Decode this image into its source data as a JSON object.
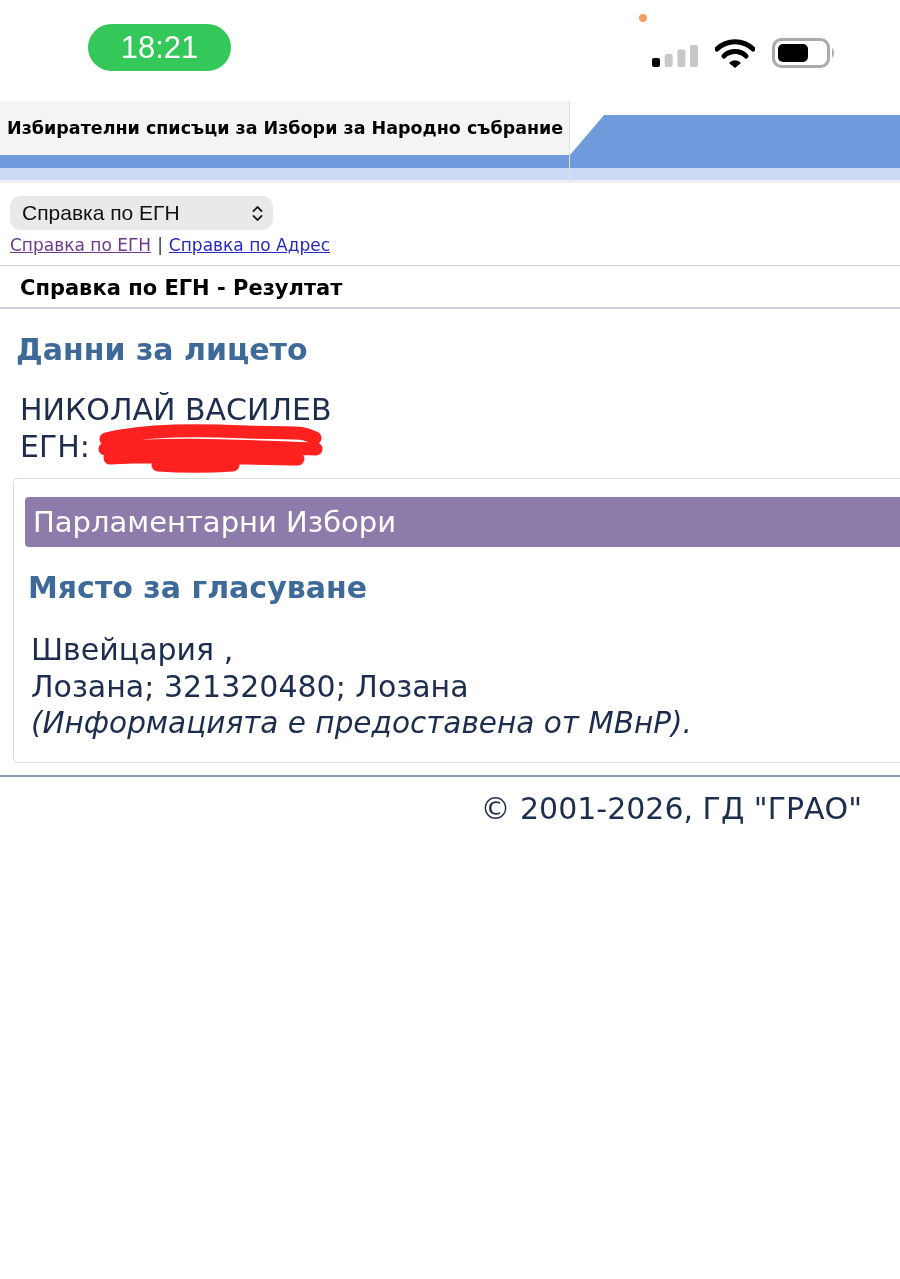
{
  "status_bar": {
    "time": "18:21"
  },
  "header": {
    "title": "Избирателни списъци за Избори за Народно събрание"
  },
  "query_select": {
    "value": "Справка по ЕГН"
  },
  "nav_links": {
    "links": [
      {
        "label": "Справка по ЕГН",
        "visited": true
      },
      {
        "label": "Справка по Адрес",
        "visited": false
      }
    ],
    "separator": "|"
  },
  "result_title": "Справка по ЕГН - Резултат",
  "person": {
    "heading": "Данни за лицето",
    "name": "НИКОЛАЙ ВАСИЛЕВ",
    "egn": {
      "label": "ЕГН:",
      "redacted": true
    }
  },
  "election_card": {
    "title": "Парламентарни Избори",
    "heading": "Място за гласуване",
    "address_lines": [
      "Швейцария ,",
      "Лозана; 321320480; Лозана"
    ],
    "note": "(Информацията е предоставена от МВнР)."
  },
  "footer": {
    "copyright": "© 2001-2026, ГД \"ГРАО\""
  }
}
